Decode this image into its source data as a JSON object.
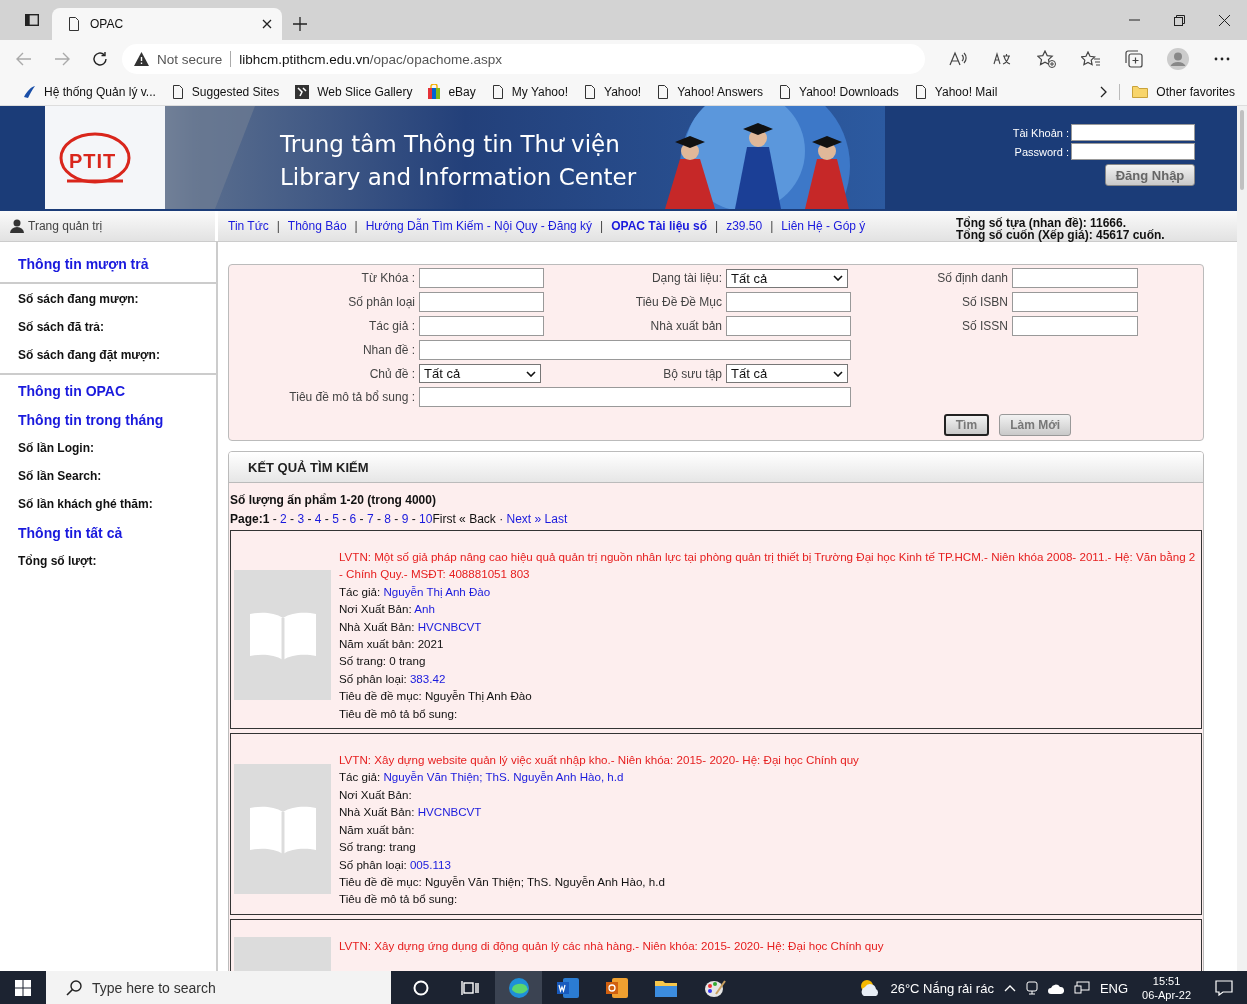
{
  "browser": {
    "tabs": [
      {
        "title": "OPAC",
        "selected": true
      }
    ],
    "address": {
      "security": "Not secure",
      "url_host": "libhcm.ptithcm.edu.vn",
      "url_path": "/opac/opachome.aspx"
    },
    "favorites": [
      {
        "label": "Hệ thống Quản lý v...",
        "kind": "logo"
      },
      {
        "label": "Suggested Sites",
        "kind": "page"
      },
      {
        "label": "Web Slice Gallery",
        "kind": "slice"
      },
      {
        "label": "eBay",
        "kind": "bag"
      },
      {
        "label": "My Yahoo!",
        "kind": "page"
      },
      {
        "label": "Yahoo!",
        "kind": "page"
      },
      {
        "label": "Yahoo! Answers",
        "kind": "page"
      },
      {
        "label": "Yahoo! Downloads",
        "kind": "page"
      },
      {
        "label": "Yahoo! Mail",
        "kind": "page"
      }
    ],
    "other_favorites": "Other favorites"
  },
  "header": {
    "logo": "PTIT",
    "title_vi": "Trung tâm Thông tin Thư viện",
    "title_en": "Library and Information Center",
    "login": {
      "account_label": "Tài Khoản :",
      "password_label": "Password :",
      "button": "Đăng Nhập"
    }
  },
  "nav": {
    "admin": "Trang quản trị",
    "links": [
      {
        "label": "Tin Tức",
        "bold": false
      },
      {
        "label": "Thông Báo",
        "bold": false
      },
      {
        "label": "Hướng Dẫn Tìm Kiếm - Nội Quy - Đăng ký",
        "bold": false
      },
      {
        "label": "OPAC Tài liệu số",
        "bold": true
      },
      {
        "label": "z39.50",
        "bold": false
      },
      {
        "label": "Liên Hệ - Góp ý",
        "bold": false
      }
    ],
    "separator": "|",
    "stats": [
      "Tổng số tựa (nhan đề): 11666.",
      "Tổng số cuốn (Xếp giá): 45617 cuốn."
    ]
  },
  "sidebar": {
    "items": [
      {
        "label": "Thông tin mượn trả",
        "kind": "heading"
      },
      {
        "kind": "rule"
      },
      {
        "label": "Số sách đang mượn:",
        "kind": "stat"
      },
      {
        "label": "Số sách đã trả:",
        "kind": "stat"
      },
      {
        "label": "Số sách đang đặt mượn:",
        "kind": "stat"
      },
      {
        "kind": "rule"
      },
      {
        "label": "Thông tin OPAC",
        "kind": "heading"
      },
      {
        "label": "Thông tin trong tháng",
        "kind": "heading"
      },
      {
        "label": "Số lần Login:",
        "kind": "stat"
      },
      {
        "label": "Số lần Search:",
        "kind": "stat"
      },
      {
        "label": "Số lần khách ghé thăm:",
        "kind": "stat"
      },
      {
        "label": "Thông tin tất cả",
        "kind": "heading"
      },
      {
        "label": "Tổng số lượt:",
        "kind": "stat"
      }
    ]
  },
  "search_form": {
    "rows": [
      [
        {
          "label": "Từ Khóa :",
          "kind": "text"
        },
        {
          "label": "Dạng tài liệu:",
          "kind": "select",
          "value": "Tất cả"
        },
        {
          "label": "Số định danh",
          "kind": "text"
        }
      ],
      [
        {
          "label": "Số phân loại",
          "kind": "text"
        },
        {
          "label": "Tiêu Đề Đề Mục",
          "kind": "text"
        },
        {
          "label": "Số ISBN",
          "kind": "text"
        }
      ],
      [
        {
          "label": "Tác giả :",
          "kind": "text"
        },
        {
          "label": "Nhà xuất bản",
          "kind": "text"
        },
        {
          "label": "Số ISSN",
          "kind": "text"
        }
      ],
      [
        {
          "label": "Nhan đề :",
          "kind": "wide"
        }
      ],
      [
        {
          "label": "Chủ đề :",
          "kind": "select",
          "value": "Tất cả"
        },
        {
          "label": "Bộ sưu tập",
          "kind": "select",
          "value": "Tất cả"
        }
      ],
      [
        {
          "label": "Tiêu đề mô tả bổ sung :",
          "kind": "wide"
        }
      ]
    ],
    "buttons": [
      {
        "label": "Tìm",
        "focused": true
      },
      {
        "label": "Làm Mới",
        "focused": false
      }
    ]
  },
  "results": {
    "title": "KẾT QUẢ TÌM KIẾM",
    "count": "Số lượng ấn phẩm 1-20 (trong 4000)",
    "page_label": "Page:",
    "page_separator": "-",
    "pages": [
      {
        "label": "1",
        "selected": true
      },
      {
        "label": "2",
        "selected": false
      },
      {
        "label": "3",
        "selected": false
      },
      {
        "label": "4",
        "selected": false
      },
      {
        "label": "5",
        "selected": false
      },
      {
        "label": "6",
        "selected": false
      },
      {
        "label": "7",
        "selected": false
      },
      {
        "label": "8",
        "selected": false
      },
      {
        "label": "9",
        "selected": false
      },
      {
        "label": "10",
        "selected": false
      }
    ],
    "page_nav": [
      {
        "text": "First",
        "disabled": true
      },
      {
        "text": "«",
        "disabled": true
      },
      {
        "text": "Back",
        "disabled": true
      },
      {
        "text": "·",
        "disabled": true
      },
      {
        "text": "Next »",
        "disabled": false
      },
      {
        "text": "Last",
        "disabled": false
      }
    ],
    "records": [
      {
        "title": "LVTN: Một số giả pháp nâng cao hiệu quả quản trị nguồn nhân lực tại phòng quản trị thiết bị Trường Đại học Kinh tế TP.HCM.- Niên khóa 2008- 2011.- Hệ: Văn bằng 2 - Chính Quy.- MSĐT: 408881051 803",
        "fields": [
          {
            "label": "Tác giả:",
            "value": "Nguyễn Thị Anh Đào",
            "link": true
          },
          {
            "label": "Nơi Xuất Bản:",
            "value": "Anh",
            "link": true
          },
          {
            "label": "Nhà Xuất Bản:",
            "value": "HVCNBCVT",
            "link": true
          },
          {
            "label": "Năm xuất bản:",
            "value": "2021",
            "link": false
          },
          {
            "label": "Số trang:",
            "value": "0  trang",
            "link": false
          },
          {
            "label": "Số phân loại:",
            "value": "383.42",
            "link": true
          },
          {
            "label": "Tiêu đề đề mục:",
            "value": "Nguyễn Thị Anh Đào",
            "link": false
          },
          {
            "label": "Tiêu đề mô tả bổ sung:",
            "link": false
          }
        ]
      },
      {
        "title": "LVTN: Xây dựng website quản lý việc xuất nhập kho.- Niên khóa: 2015- 2020- Hệ: Đại học Chính quy",
        "fields": [
          {
            "label": "Tác giả:",
            "value": "Nguyễn Văn Thiện; ThS. Nguyễn Anh Hào, h.d",
            "link": true
          },
          {
            "label": "Nơi Xuất Bản:",
            "link": false
          },
          {
            "label": "Nhà Xuất Bản:",
            "value": "HVCNBCVT",
            "link": true
          },
          {
            "label": "Năm xuất bản:",
            "link": false
          },
          {
            "label": "Số trang:",
            "value": " trang",
            "link": false
          },
          {
            "label": "Số phân loại:",
            "value": "005.113",
            "link": true
          },
          {
            "label": "Tiêu đề đề mục:",
            "value": "Nguyễn Văn Thiện; ThS. Nguyễn Anh Hào, h.d",
            "link": false
          },
          {
            "label": "Tiêu đề mô tả bổ sung:",
            "link": false
          }
        ]
      },
      {
        "title": "LVTN: Xây dựng ứng dụng di động quản lý các nhà hàng.- Niên khóa: 2015- 2020- Hệ: Đại học Chính quy"
      }
    ]
  },
  "taskbar": {
    "search_placeholder": "Type here to search",
    "weather": "26°C  Nắng rải rác",
    "language": "ENG",
    "time": "15:51",
    "date": "06-Apr-22"
  }
}
